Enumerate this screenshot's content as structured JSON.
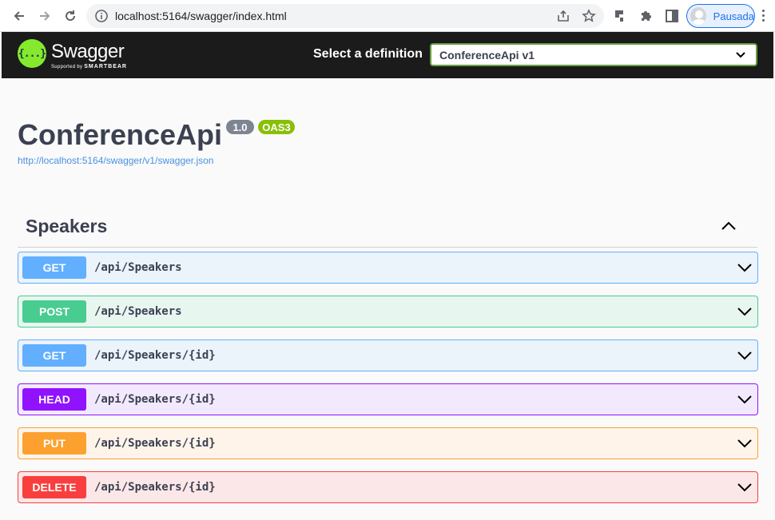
{
  "browser": {
    "url": "localhost:5164/swagger/index.html",
    "profile_name": "Pausada",
    "icons": [
      "back-icon",
      "forward-icon",
      "reload-icon",
      "info-icon",
      "share-icon",
      "star-icon",
      "extension-icon",
      "puzzle-icon",
      "sidebar-icon",
      "avatar",
      "kebab-icon"
    ]
  },
  "topbar": {
    "brand": "Swagger",
    "brand_sub_prefix": "Supported by",
    "brand_sub_company": "SMARTBEAR",
    "logo_glyph": "{...}",
    "definition_label": "Select a definition",
    "definition_value": "ConferenceApi v1"
  },
  "info": {
    "title": "ConferenceApi",
    "version": "1.0",
    "oas": "OAS3",
    "spec_url": "http://localhost:5164/swagger/v1/swagger.json"
  },
  "tag": {
    "name": "Speakers",
    "operations": [
      {
        "method": "GET",
        "path": "/api/Speakers"
      },
      {
        "method": "POST",
        "path": "/api/Speakers"
      },
      {
        "method": "GET",
        "path": "/api/Speakers/{id}"
      },
      {
        "method": "HEAD",
        "path": "/api/Speakers/{id}"
      },
      {
        "method": "PUT",
        "path": "/api/Speakers/{id}"
      },
      {
        "method": "DELETE",
        "path": "/api/Speakers/{id}"
      }
    ]
  },
  "colors": {
    "get": "#61affe",
    "post": "#49cc90",
    "head": "#9012fe",
    "put": "#fca130",
    "delete": "#f93e3e",
    "topbar": "#1b1b1b",
    "swagger_green": "#85ea2d"
  }
}
